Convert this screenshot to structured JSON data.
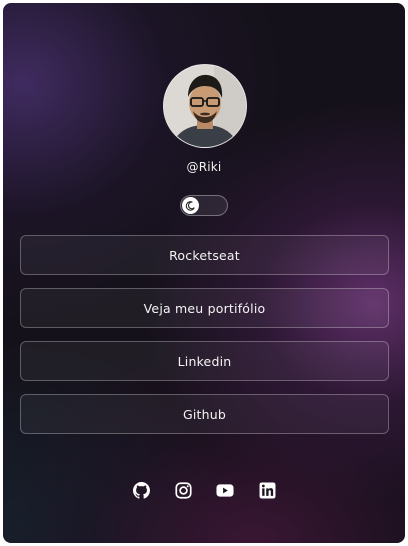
{
  "profile": {
    "username": "@Riki"
  },
  "theme_toggle": {
    "state": "dark"
  },
  "links": [
    {
      "label": "Rocketseat"
    },
    {
      "label": "Veja meu portifólio"
    },
    {
      "label": "Linkedin"
    },
    {
      "label": "Github"
    }
  ],
  "socials": [
    "github-icon",
    "instagram-icon",
    "youtube-icon",
    "linkedin-icon"
  ],
  "colors": {
    "background": "#15111a",
    "text": "#f4f4f4",
    "accent_purple": "#6c3476"
  }
}
